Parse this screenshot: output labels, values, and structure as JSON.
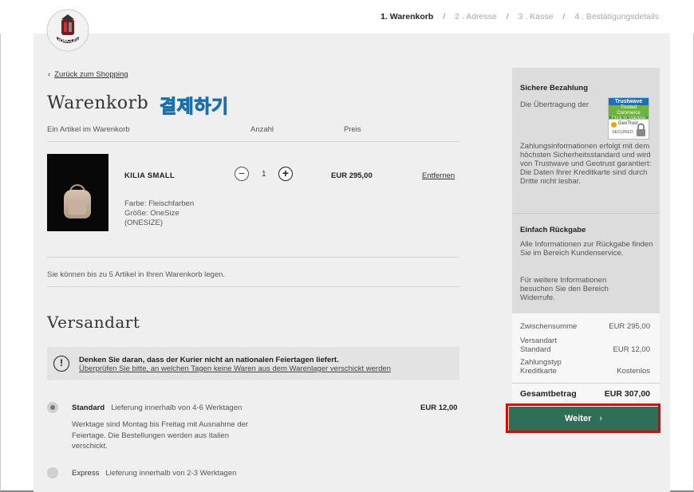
{
  "header": {
    "logo_text": "MONCLER",
    "steps": [
      {
        "label": "1. Warenkorb",
        "active": true
      },
      {
        "label": "2 . Adresse",
        "active": false
      },
      {
        "label": "3 . Kasse",
        "active": false
      },
      {
        "label": "4 . Bestätigungsdetails",
        "active": false
      }
    ],
    "step_separator": "/"
  },
  "cart": {
    "back_link": "Zurück zum Shopping",
    "title": "Warenkorb",
    "overlay_text": "결제하기",
    "item_count": "Ein Artikel im Warenkorb",
    "col_quantity": "Anzahl",
    "col_price": "Preis",
    "item": {
      "name": "KILIA SMALL",
      "color": "Farbe:  Fleischfarben",
      "size": "Größe:  OneSize",
      "size_code": "(ONESIZE)",
      "quantity": "1",
      "decrement": "−",
      "increment": "+",
      "price": "EUR 295,00",
      "remove": "Entfernen"
    },
    "limit_note": "Sie können bis zu 5 Artikel in Ihren Warenkorb legen."
  },
  "shipping": {
    "title": "Versandart",
    "notice_icon": "!",
    "notice_title": "Denken Sie daran, dass der Kurier nicht an nationalen Feiertagen liefert.",
    "notice_link": "Überprüfen Sie bitte, an welchen Tagen keine Waren aus dem Warenlager verschickt werden",
    "options": [
      {
        "name": "Standard",
        "description": "Lieferung innerhalb von 4-6 Werktagen",
        "price": "EUR 12,00",
        "selected": true,
        "info": "Werktage sind Montag bis Freitag mit Ausnahme der Feiertage. Die Bestellungen werden aus Italien verschickt."
      },
      {
        "name": "Express",
        "description": "Lieferung innerhalb von 2-3 Werktagen",
        "selected": false
      }
    ]
  },
  "sidebar": {
    "secure_title": "Sichere Bezahlung",
    "secure_text_1": "Die Übertragung der",
    "secure_text_2": "Zahlungsinformationen erfolgt mit dem höchsten Sicherheitsstandard und wird von Trustwave und Geotrust garantiert: Die Daten Ihrer Kreditkarte sind durch Dritte nicht lesbar.",
    "trustwave_badge": "Trustwave",
    "trustwave_sub": "Trusted Commerce",
    "trustwave_click": "Click to Validate",
    "geotrust_badge": "GeoTrust",
    "geotrust_sub": "SECURED",
    "return_title": "Einfach Rückgabe",
    "return_text_1": "Alle Informationen zur Rückgabe finden Sie im Bereich Kundenservice.",
    "return_text_2": "Für weitere Informationen besuchen Sie den Bereich Widerrufe.",
    "summary": {
      "subtotal_label": "Zwischensumme",
      "subtotal_value": "EUR 295,00",
      "shipping_label": "Versandart\nStandard",
      "shipping_value": "EUR 12,00",
      "payment_label": "Zahlungstyp\nKreditkarte",
      "payment_value": "Kostenlos",
      "total_label": "Gesamtbetrag",
      "total_value": "EUR 307,00"
    },
    "continue_button": "Weiter",
    "continue_arrow": "›"
  },
  "colors": {
    "accent_green": "#2f6e57",
    "highlight_red": "#e00000",
    "overlay_blue": "#2fa8e8"
  }
}
